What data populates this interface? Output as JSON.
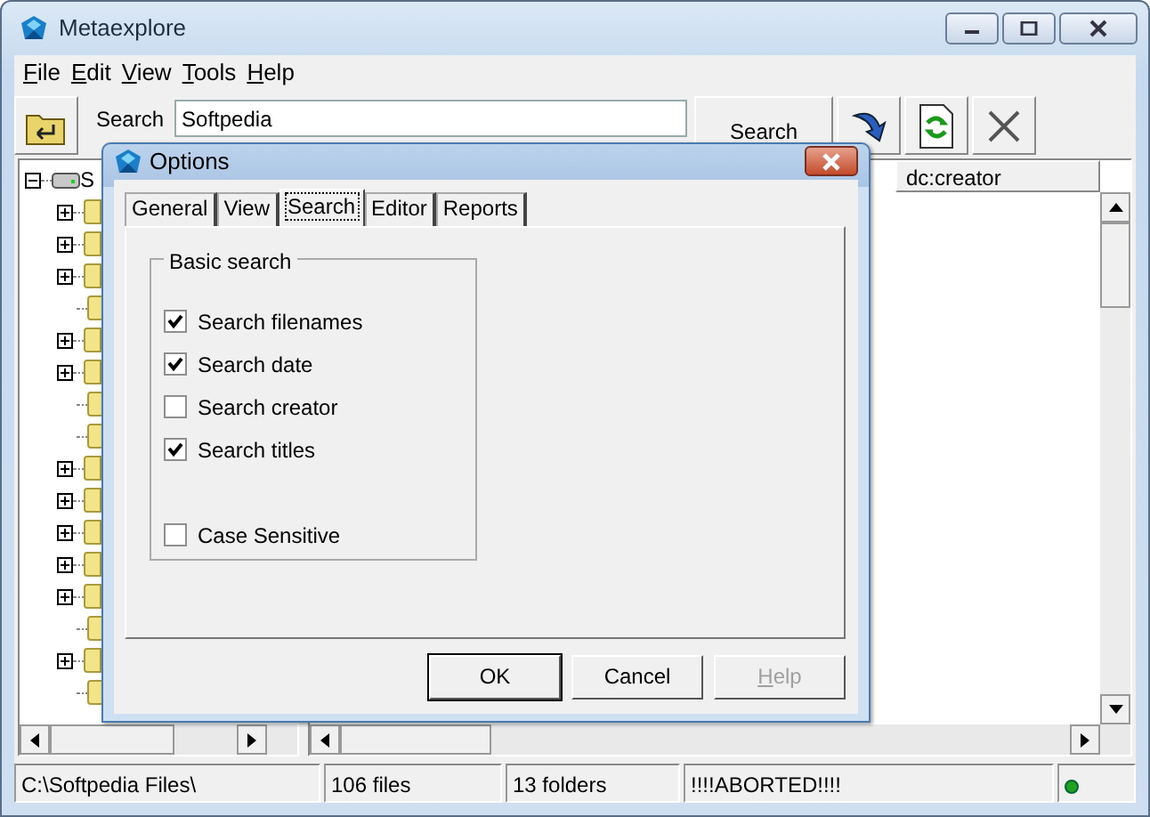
{
  "window": {
    "title": "Metaexplore"
  },
  "menu": [
    "File",
    "Edit",
    "View",
    "Tools",
    "Help"
  ],
  "toolbar": {
    "search_label": "Search",
    "search_value": "Softpedia",
    "search_button": "Search"
  },
  "tree": {
    "root": {
      "label": "S",
      "expanded": true
    },
    "children": [
      {
        "expandable": true
      },
      {
        "expandable": true
      },
      {
        "expandable": true
      },
      {
        "expandable": false
      },
      {
        "expandable": true
      },
      {
        "expandable": true
      },
      {
        "expandable": false
      },
      {
        "expandable": false
      },
      {
        "expandable": true
      },
      {
        "expandable": true
      },
      {
        "expandable": true
      },
      {
        "expandable": true
      },
      {
        "expandable": true
      },
      {
        "expandable": false
      },
      {
        "expandable": true
      },
      {
        "expandable": false
      }
    ]
  },
  "list": {
    "columns": [
      "dc:creator"
    ]
  },
  "status_bar": [
    "C:\\Softpedia Files\\",
    "106 files",
    "13 folders",
    "!!!!ABORTED!!!!"
  ],
  "dialog": {
    "title": "Options",
    "tabs": [
      {
        "label": "General",
        "selected": false
      },
      {
        "label": "View",
        "selected": false
      },
      {
        "label": "Search",
        "selected": true
      },
      {
        "label": "Editor",
        "selected": false
      },
      {
        "label": "Reports",
        "selected": false
      }
    ],
    "group": {
      "title": "Basic search",
      "options": [
        {
          "label": "Search filenames",
          "checked": true
        },
        {
          "label": "Search date",
          "checked": true
        },
        {
          "label": "Search creator",
          "checked": false
        },
        {
          "label": "Search titles",
          "checked": true
        },
        {
          "label": "Case Sensitive",
          "checked": false
        }
      ]
    },
    "buttons": [
      {
        "label": "OK",
        "default": true,
        "disabled": false
      },
      {
        "label": "Cancel",
        "default": false,
        "disabled": false
      },
      {
        "label": "Help",
        "default": false,
        "disabled": true
      }
    ]
  }
}
